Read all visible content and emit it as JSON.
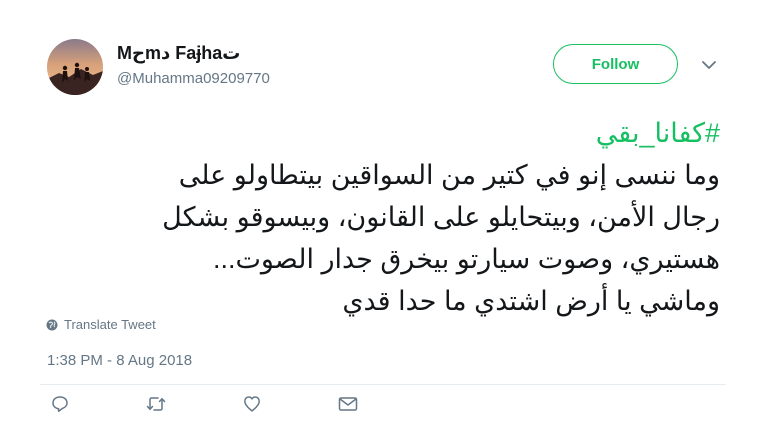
{
  "author": {
    "display_name": "Mحmد Faɉhaت",
    "username": "@Muhamma09209770"
  },
  "header": {
    "follow_label": "Follow",
    "menu_icon": "chevron-down-icon"
  },
  "tweet": {
    "hashtag": "#كفانا_بقي",
    "lines": [
      "وما ننسى إنو في كتير من السواقين بيتطاولو على",
      "رجال الأمن، وبيتحايلو على القانون، وبيسوقو بشكل",
      "هستيري، وصوت سيارتو بيخرق جدار الصوت...",
      "وماشي يا أرض اشتدي ما حدا قدي"
    ]
  },
  "translate": {
    "label": "Translate Tweet",
    "icon": "globe-icon"
  },
  "timestamp": "1:38 PM - 8 Aug 2018",
  "actions": [
    {
      "name": "reply",
      "icon": "reply-icon"
    },
    {
      "name": "retweet",
      "icon": "retweet-icon"
    },
    {
      "name": "like",
      "icon": "heart-icon"
    },
    {
      "name": "direct-message",
      "icon": "envelope-icon"
    }
  ],
  "colors": {
    "accent": "#17bf63",
    "text": "#14171a",
    "secondary": "#657786",
    "divider": "#e6ecf0"
  }
}
